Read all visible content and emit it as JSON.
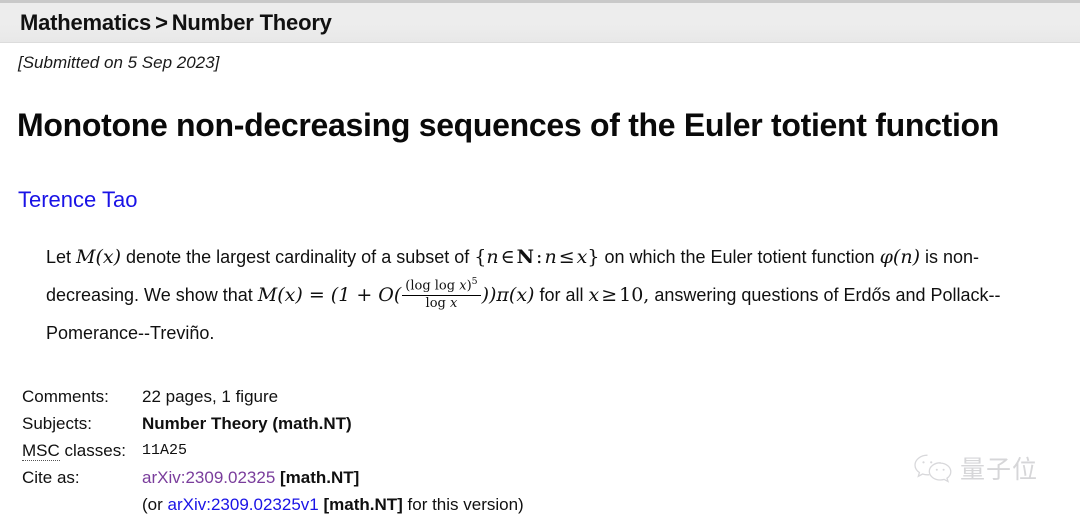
{
  "breadcrumb": {
    "primary": "Mathematics",
    "separator": ">",
    "secondary": "Number Theory"
  },
  "submitted": "[Submitted on 5 Sep 2023]",
  "title": "Monotone non-decreasing sequences of the Euler totient function",
  "authors": "Terence Tao",
  "abstract": {
    "part1": "Let ",
    "m_of_x_1": "M(x)",
    "part2": " denote the largest cardinality of a subset of ",
    "set_open": "{",
    "set_n": "n",
    "set_in": "∈",
    "set_N": "N",
    "set_colon": ":",
    "set_n2": "n",
    "set_le": "≤",
    "set_x": "x",
    "set_close": "}",
    "part3": " on which the Euler totient function ",
    "phi_of_n": "φ(n)",
    "part4": " is non-decreasing. We show that ",
    "eq_lhs": "M(x) = (1 + O(",
    "frac_num_text": "(log log ",
    "frac_num_var": "x",
    "frac_num_close": ")",
    "frac_num_exp": "5",
    "frac_den_text": "log ",
    "frac_den_var": "x",
    "eq_rhs": "))π(x)",
    "part5": " for all ",
    "x_var": "x",
    "ge": "≥",
    "ten": "10,",
    "part6": "answering questions of Erdős and Pollack--Pomerance--Treviño."
  },
  "metadata": {
    "rows": [
      {
        "label": "Comments:",
        "value": "22 pages, 1 figure",
        "style": "plain"
      },
      {
        "label": "Subjects:",
        "value": "Number Theory (math.NT)",
        "style": "bold"
      },
      {
        "label_abbr": "MSC",
        "label_rest": " classes:",
        "value": "11A25",
        "style": "mono"
      },
      {
        "label": "Cite as:",
        "link": "arXiv:2309.02325",
        "tag": "[math.NT]",
        "style": "link-visited"
      }
    ],
    "cite_label": "Cite as:",
    "cite_link": "arXiv:2309.02325",
    "cite_tag": "[math.NT]",
    "version_prefix": "(or ",
    "version_link": "arXiv:2309.02325v1",
    "version_tag": "[math.NT]",
    "version_suffix": " for this version)"
  },
  "watermark": {
    "icon": "wechat-bubbles-icon",
    "text": "量子位"
  },
  "colors": {
    "link_unvisited": "#1a13e6",
    "link_visited": "#7a3d9c",
    "header_bar": "#ededed",
    "page_background": "#ffffff",
    "text": "#101010",
    "watermark": "#cfcfd2"
  }
}
